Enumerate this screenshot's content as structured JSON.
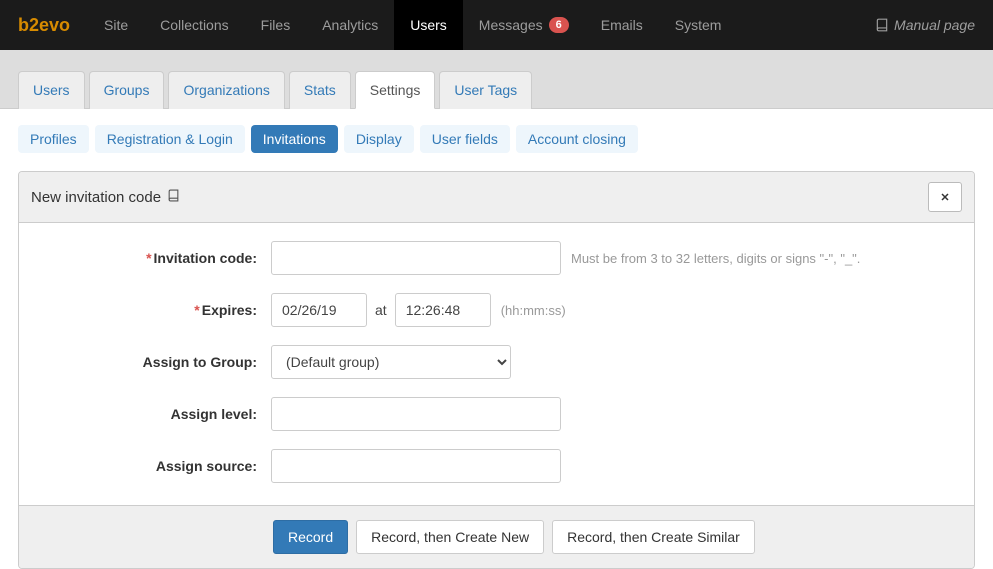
{
  "brand": "b2evo",
  "topnav": {
    "items": [
      {
        "label": "Site"
      },
      {
        "label": "Collections"
      },
      {
        "label": "Files"
      },
      {
        "label": "Analytics"
      },
      {
        "label": "Users",
        "active": true
      },
      {
        "label": "Messages",
        "badge": "6"
      },
      {
        "label": "Emails"
      },
      {
        "label": "System"
      }
    ],
    "manual_label": "Manual page"
  },
  "tabs1": {
    "items": [
      {
        "label": "Users"
      },
      {
        "label": "Groups"
      },
      {
        "label": "Organizations"
      },
      {
        "label": "Stats"
      },
      {
        "label": "Settings",
        "active": true
      },
      {
        "label": "User Tags"
      }
    ]
  },
  "pills": {
    "items": [
      {
        "label": "Profiles"
      },
      {
        "label": "Registration & Login"
      },
      {
        "label": "Invitations",
        "active": true
      },
      {
        "label": "Display"
      },
      {
        "label": "User fields"
      },
      {
        "label": "Account closing"
      }
    ]
  },
  "panel": {
    "title": "New invitation code",
    "fields": {
      "invitation_code": {
        "label": "Invitation code:",
        "required": true,
        "value": "",
        "help": "Must be from 3 to 32 letters, digits or signs \"-\", \"_\"."
      },
      "expires": {
        "label": "Expires:",
        "required": true,
        "date": "02/26/19",
        "at_label": "at",
        "time": "12:26:48",
        "help": "(hh:mm:ss)"
      },
      "group": {
        "label": "Assign to Group:",
        "value": "(Default group)"
      },
      "level": {
        "label": "Assign level:",
        "value": ""
      },
      "source": {
        "label": "Assign source:",
        "value": ""
      }
    },
    "buttons": {
      "record": "Record",
      "record_new": "Record, then Create New",
      "record_similar": "Record, then Create Similar"
    }
  }
}
